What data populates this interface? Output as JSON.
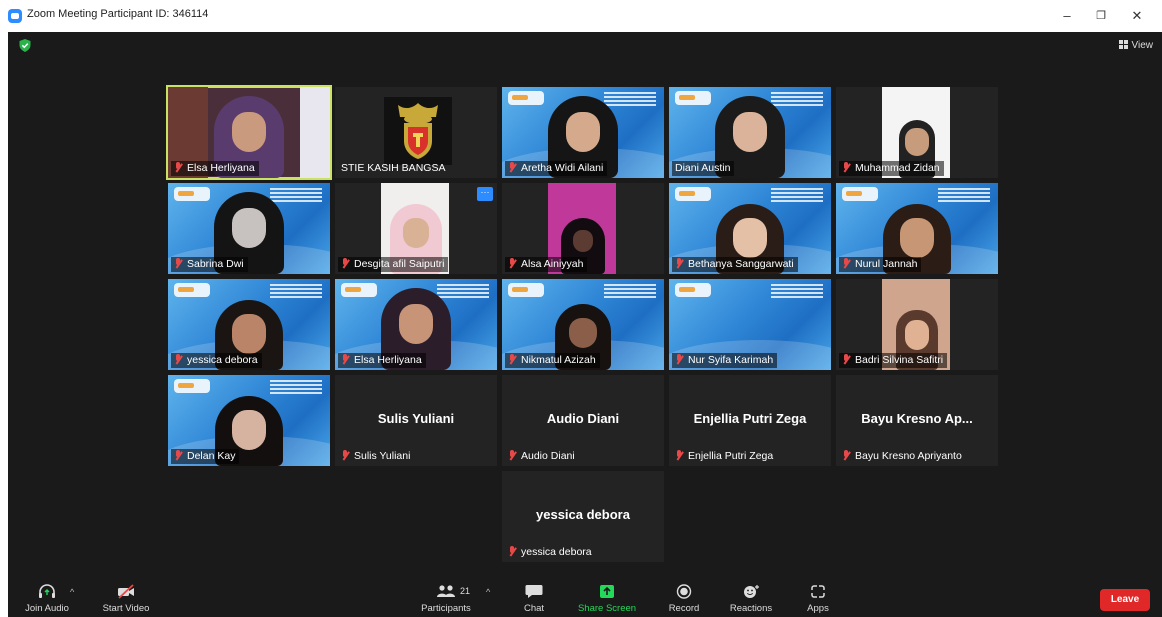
{
  "window": {
    "title": "Zoom Meeting Participant ID: 346114",
    "controls": {
      "minimize": "–",
      "restore": "❐",
      "close": "✕"
    }
  },
  "header": {
    "security_icon": "shield-check-icon",
    "view_label": "View"
  },
  "tiles": [
    {
      "name": "Elsa Herliyana",
      "video": "camera",
      "speaking": true
    },
    {
      "name": "STIE KASIH BANGSA",
      "video": "logo",
      "muted": false
    },
    {
      "name": "Aretha Widi Ailani",
      "video": "virtual-bg"
    },
    {
      "name": "Diani Austin",
      "video": "virtual-bg",
      "muted": false
    },
    {
      "name": "Muhammad Zidan",
      "video": "camera"
    },
    {
      "name": "Sabrina Dwi",
      "video": "virtual-bg"
    },
    {
      "name": "Desgita afil Saiputri",
      "video": "camera",
      "more_button": "···"
    },
    {
      "name": "Alsa Ainiyyah",
      "video": "camera"
    },
    {
      "name": "Bethanya Sanggarwati",
      "video": "virtual-bg"
    },
    {
      "name": "Nurul Jannah",
      "video": "virtual-bg"
    },
    {
      "name": "yessica debora",
      "video": "virtual-bg"
    },
    {
      "name": "Elsa Herliyana",
      "video": "virtual-bg"
    },
    {
      "name": "Nikmatul Azizah",
      "video": "virtual-bg"
    },
    {
      "name": "Nur Syifa Karimah",
      "video": "virtual-bg"
    },
    {
      "name": "Badri Silvina Safitri",
      "video": "camera"
    },
    {
      "name": "Delan Kay",
      "video": "virtual-bg"
    },
    {
      "name": "Sulis Yuliani",
      "video": "off",
      "display": "Sulis Yuliani"
    },
    {
      "name": "Audio Diani",
      "video": "off",
      "display": "Audio Diani"
    },
    {
      "name": "Enjellia Putri Zega",
      "video": "off",
      "display": "Enjellia Putri Zega"
    },
    {
      "name": "Bayu Kresno Apriyanto",
      "video": "off",
      "display": "Bayu Kresno Ap..."
    },
    {
      "name": "yessica debora",
      "video": "off",
      "display": "yessica debora"
    }
  ],
  "toolbar": {
    "join_audio": "Join Audio",
    "start_video": "Start Video",
    "participants": "Participants",
    "participants_count": "21",
    "chat": "Chat",
    "share_screen": "Share Screen",
    "record": "Record",
    "reactions": "Reactions",
    "apps": "Apps",
    "leave": "Leave",
    "share_color": "#23d959",
    "leave_color": "#e02828"
  }
}
